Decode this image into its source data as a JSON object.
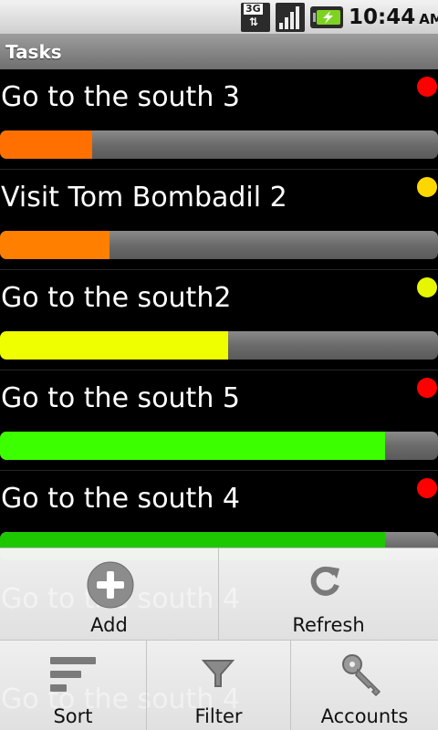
{
  "status_bar": {
    "network_badge": "3G",
    "time": "10:44",
    "ampm": "AM",
    "icons": [
      "network-3g-icon",
      "signal-icon",
      "battery-charging-icon"
    ]
  },
  "title_bar": {
    "title": "Tasks"
  },
  "tasks": [
    {
      "name": "Go to the south 3",
      "progress_percent": 21,
      "bar_color": "#ff7000",
      "dot_color": "#ff0000"
    },
    {
      "name": "Visit Tom Bombadil 2",
      "progress_percent": 25,
      "bar_color": "#ff7f00",
      "dot_color": "#ffd700"
    },
    {
      "name": "Go to the south2",
      "progress_percent": 52,
      "bar_color": "#f0ff00",
      "dot_color": "#e6f500"
    },
    {
      "name": "Go to the south 5",
      "progress_percent": 88,
      "bar_color": "#3cff00",
      "dot_color": "#ff0000"
    },
    {
      "name": "Go to the south 4",
      "progress_percent": 88,
      "bar_color": "#1ec800",
      "dot_color": "#ff0000"
    }
  ],
  "background_ghost_rows": [
    "Go to the south 4",
    "Go to the south 4"
  ],
  "menu": {
    "items": [
      {
        "label": "Add",
        "icon": "add-icon"
      },
      {
        "label": "Refresh",
        "icon": "refresh-icon"
      },
      {
        "label": "Sort",
        "icon": "sort-icon"
      },
      {
        "label": "Filter",
        "icon": "filter-icon"
      },
      {
        "label": "Accounts",
        "icon": "accounts-key-icon"
      }
    ]
  },
  "colors": {
    "background": "#000000",
    "title_bar": "#8a8a8a",
    "progress_track": "#6b6b6b"
  }
}
